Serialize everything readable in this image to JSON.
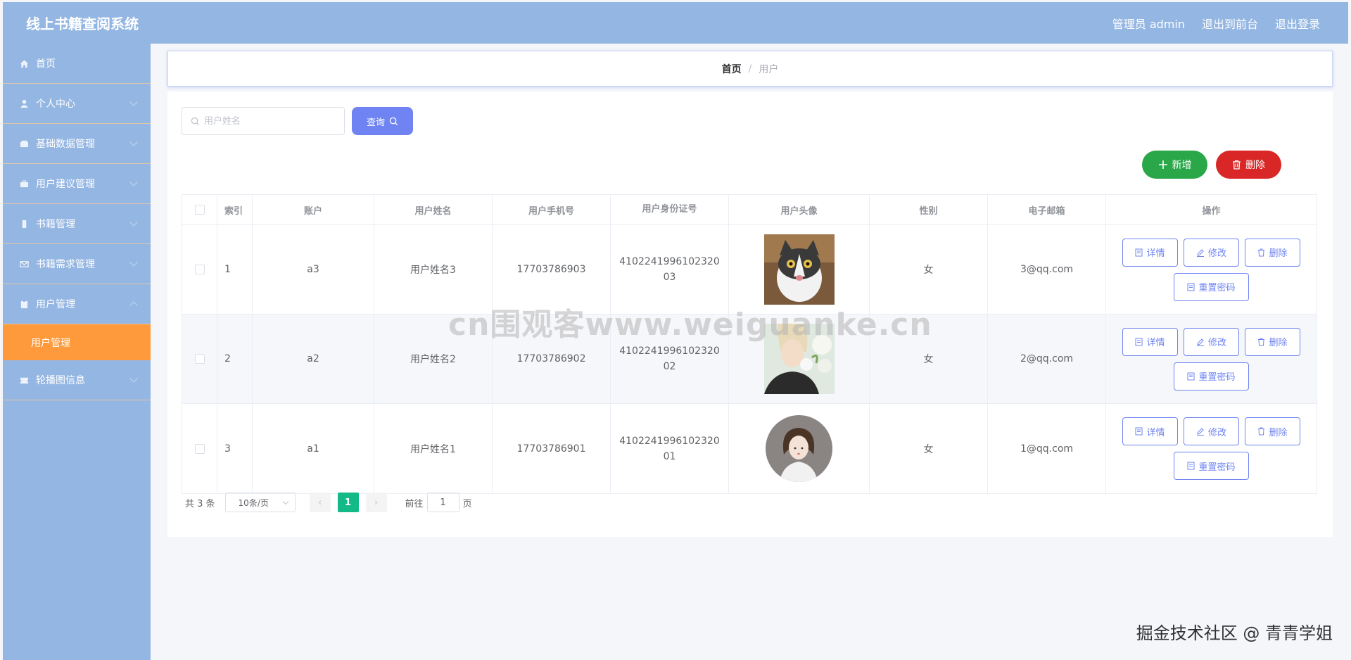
{
  "header": {
    "title": "线上书籍查阅系统",
    "user": "管理员 admin",
    "to_front": "退出到前台",
    "logout": "退出登录"
  },
  "sidebar": {
    "items": [
      {
        "label": "首页",
        "icon": "home-icon"
      },
      {
        "label": "个人中心",
        "icon": "person-icon"
      },
      {
        "label": "基础数据管理",
        "icon": "wallet-icon"
      },
      {
        "label": "用户建议管理",
        "icon": "briefcase-icon"
      },
      {
        "label": "书籍管理",
        "icon": "phone-icon"
      },
      {
        "label": "书籍需求管理",
        "icon": "mail-icon"
      },
      {
        "label": "用户管理",
        "icon": "clipboard-icon"
      },
      {
        "label": "用户管理",
        "icon": "",
        "active": true
      },
      {
        "label": "轮播图信息",
        "icon": "ticket-icon"
      }
    ]
  },
  "breadcrumb": {
    "home": "首页",
    "sep": "/",
    "current": "用户"
  },
  "search": {
    "placeholder": "用户姓名",
    "button": "查询"
  },
  "actions": {
    "add": "新增",
    "delete": "删除"
  },
  "table": {
    "headers": [
      "索引",
      "账户",
      "用户姓名",
      "用户手机号",
      "用户身份证号",
      "用户头像",
      "性别",
      "电子邮箱",
      "操作"
    ],
    "rows": [
      {
        "index": "1",
        "account": "a3",
        "name": "用户姓名3",
        "phone": "17703786903",
        "id_card": "410224199610232003",
        "sex": "女",
        "email": "3@qq.com"
      },
      {
        "index": "2",
        "account": "a2",
        "name": "用户姓名2",
        "phone": "17703786902",
        "id_card": "410224199610232002",
        "sex": "女",
        "email": "2@qq.com"
      },
      {
        "index": "3",
        "account": "a1",
        "name": "用户姓名1",
        "phone": "17703786901",
        "id_card": "410224199610232001",
        "sex": "女",
        "email": "1@qq.com"
      }
    ],
    "ops": {
      "detail": "详情",
      "edit": "修改",
      "delete": "删除",
      "reset": "重置密码"
    }
  },
  "pagination": {
    "total": "共 3 条",
    "page_size": "10条/页",
    "current": "1",
    "goto": "前往",
    "goto_value": "1",
    "page_unit": "页"
  },
  "watermark": "cn围观客www.weiguanke.cn",
  "footer_mark": "掘金技术社区 @ 青青学姐",
  "colors": {
    "header": "#94b6e2",
    "active": "#ff9a3c",
    "primary": "#6f84f2",
    "success": "#2aa748",
    "danger": "#d92626",
    "page": "#14b988"
  }
}
